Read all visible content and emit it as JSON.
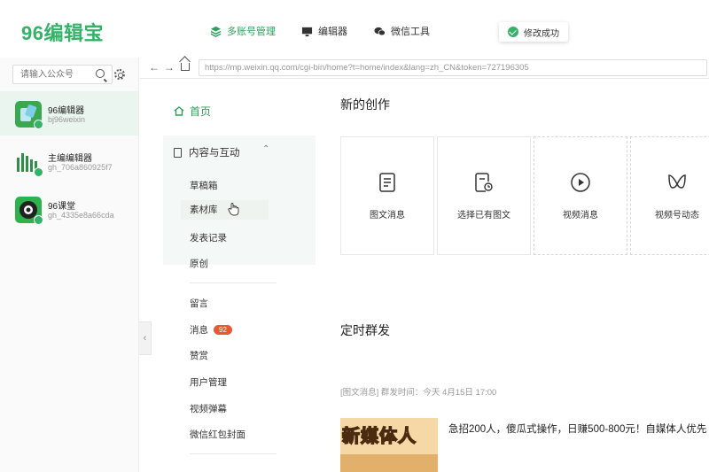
{
  "app": {
    "logo": "96编辑宝",
    "nav": {
      "accounts": "多账号管理",
      "editor": "编辑器",
      "wechat_tools": "微信工具"
    },
    "toast": "修改成功"
  },
  "sidebar": {
    "search_placeholder": "请输入公众号",
    "accounts": [
      {
        "name": "96编辑器",
        "id": "bj96weixin",
        "active": true
      },
      {
        "name": "主编编辑器",
        "id": "gh_706a860925f7",
        "active": false
      },
      {
        "name": "96课堂",
        "id": "gh_4335e8a66cda",
        "active": false
      }
    ],
    "collapse_icon": "‹"
  },
  "browser": {
    "url": "https://mp.weixin.qq.com/cgi-bin/home?t=home/index&lang=zh_CN&token=727196305"
  },
  "mp_menu": {
    "home": "首页",
    "section": "内容与互动",
    "items": [
      "草稿箱",
      "素材库",
      "发表记录",
      "原创"
    ],
    "items2": [
      "留言",
      "消息",
      "赞赏",
      "用户管理",
      "视频弹幕",
      "微信红包封面"
    ],
    "message_count": "92"
  },
  "main": {
    "create_title": "新的创作",
    "cards": [
      "图文消息",
      "选择已有图文",
      "视频消息",
      "视频号动态"
    ],
    "scheduled_title": "定时群发",
    "scheduled_meta": "[图文消息]   群发时间：今天 4月15日 17:00",
    "thumb_text": "新媒体人",
    "article_title": "急招200人，傻瓜式操作，日赚500-800元！自媒体人优先"
  }
}
